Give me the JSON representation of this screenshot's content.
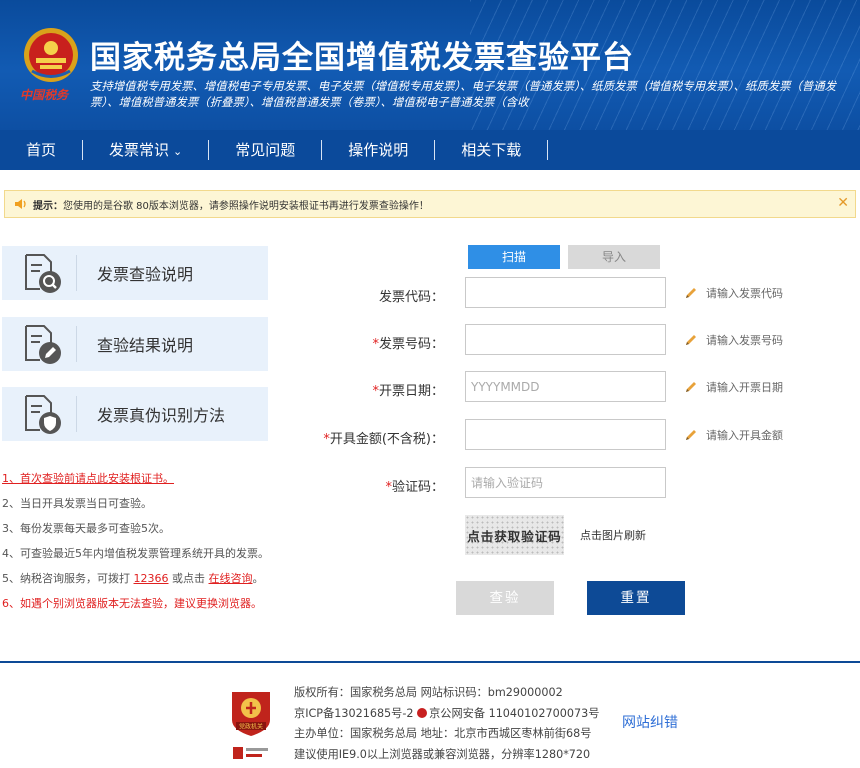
{
  "header": {
    "title": "国家税务总局全国增值税发票查验平台",
    "subtitle": "支持增值税专用发票、增值税电子专用发票、电子发票（增值税专用发票）、电子发票（普通发票）、纸质发票（增值税专用发票）、纸质发票（普通发票）、增值税普通发票（折叠票）、增值税普通发票（卷票）、增值税电子普通发票（含收",
    "motto": "中国税务"
  },
  "nav": {
    "items": [
      {
        "label": "首页"
      },
      {
        "label": "发票常识",
        "caret": "⌄"
      },
      {
        "label": "常见问题"
      },
      {
        "label": "操作说明"
      },
      {
        "label": "相关下载"
      }
    ]
  },
  "notice": {
    "prefix": "提示：",
    "text": "您使用的是谷歌 80版本浏览器，请参照操作说明安装根证书再进行发票查验操作！",
    "close": "✕"
  },
  "cards": [
    {
      "label": "发票查验说明",
      "icon": "doc-search-icon"
    },
    {
      "label": "查验结果说明",
      "icon": "doc-edit-icon"
    },
    {
      "label": "发票真伪识别方法",
      "icon": "doc-shield-icon"
    }
  ],
  "notes": {
    "n1": "1、首次查验前请点此安装根证书。",
    "n2": "2、当日开具发票当日可查验。",
    "n3": "3、每份发票每天最多可查验5次。",
    "n4": "4、可查验最近5年内增值税发票管理系统开具的发票。",
    "n5_pre": "5、纳税咨询服务，可拨打 ",
    "n5_phone": "12366",
    "n5_mid": " 或点击 ",
    "n5_link": "在线咨询",
    "n5_post": "。",
    "n6": "6、如遇个别浏览器版本无法查验，建议更换浏览器。"
  },
  "tabs": {
    "scan": "扫描",
    "import": "导入"
  },
  "form": {
    "code": {
      "label": "发票代码：",
      "required": "",
      "value": "",
      "placeholder": "",
      "hint": "请输入发票代码"
    },
    "number": {
      "label": "发票号码：",
      "required": "*",
      "value": "",
      "placeholder": "",
      "hint": "请输入发票号码"
    },
    "date": {
      "label": "开票日期：",
      "required": "*",
      "value": "",
      "placeholder": "YYYYMMDD",
      "hint": "请输入开票日期"
    },
    "amount": {
      "label": "开具金额(不含税)：",
      "required": "*",
      "value": "",
      "placeholder": "",
      "hint": "请输入开具金额"
    },
    "captcha": {
      "label": "验证码：",
      "required": "*",
      "value": "",
      "placeholder": "请输入验证码"
    }
  },
  "captcha": {
    "image_text": "点击获取验证码",
    "tip": "点击图片刷新"
  },
  "buttons": {
    "check": "查验",
    "reset": "重置"
  },
  "footer": {
    "line1": "版权所有：国家税务总局 网站标识码：bm29000002",
    "line2_a": "京ICP备13021685号-2 ",
    "line2_b": "京公网安备 11040102700073号",
    "line3": "主办单位：国家税务总局 地址：北京市西城区枣林前街68号",
    "line4": "建议使用IE9.0以上浏览器或兼容浏览器，分辨率1280*720",
    "link": "网站纠错",
    "logo_text": "党政机关"
  },
  "colors": {
    "brand": "#0d4a96",
    "accent": "#2f8fe6",
    "required": "#e02020"
  }
}
